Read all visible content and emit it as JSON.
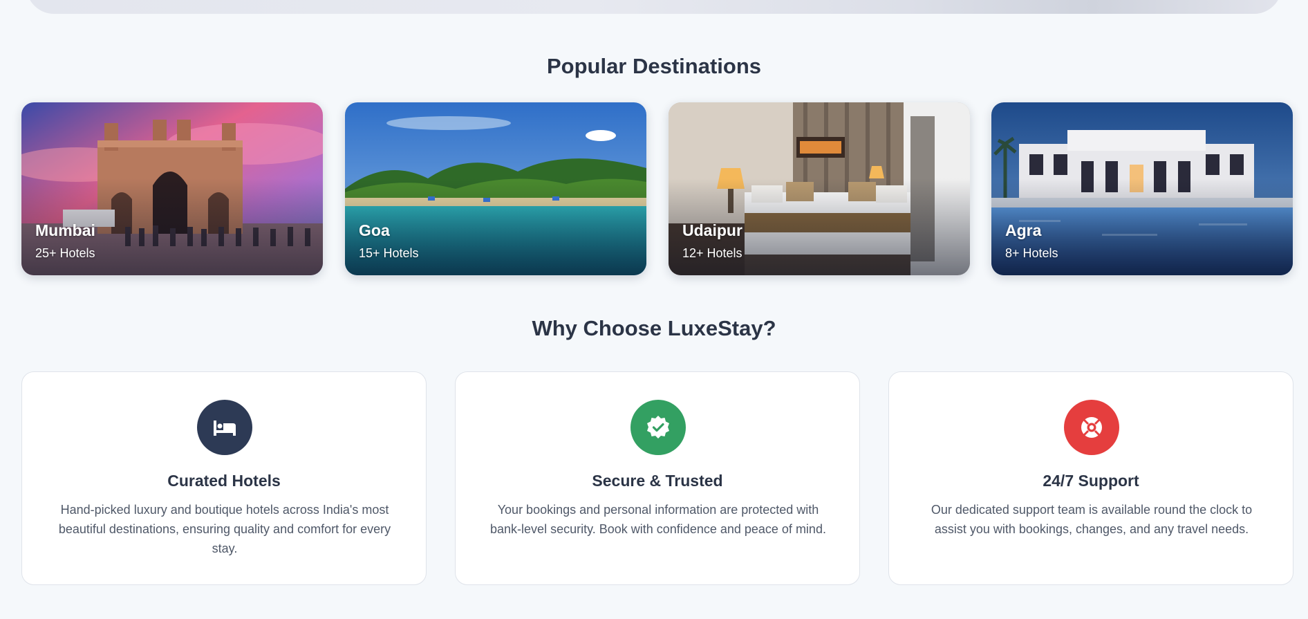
{
  "destinations_section": {
    "title": "Popular Destinations",
    "cards": [
      {
        "name": "Mumbai",
        "count": "25+ Hotels"
      },
      {
        "name": "Goa",
        "count": "15+ Hotels"
      },
      {
        "name": "Udaipur",
        "count": "12+ Hotels"
      },
      {
        "name": "Agra",
        "count": "8+ Hotels"
      }
    ]
  },
  "why_section": {
    "title": "Why Choose LuxeStay?",
    "features": [
      {
        "icon": "bed-icon",
        "icon_color": "#2d3a55",
        "title": "Curated Hotels",
        "description": "Hand-picked luxury and boutique hotels across India's most beautiful destinations, ensuring quality and comfort for every stay."
      },
      {
        "icon": "verified-badge-icon",
        "icon_color": "#33a062",
        "title": "Secure & Trusted",
        "description": "Your bookings and personal information are protected with bank-level security. Book with confidence and peace of mind."
      },
      {
        "icon": "lifebuoy-icon",
        "icon_color": "#e53e3e",
        "title": "24/7 Support",
        "description": "Our dedicated support team is available round the clock to assist you with bookings, changes, and any travel needs."
      }
    ]
  }
}
